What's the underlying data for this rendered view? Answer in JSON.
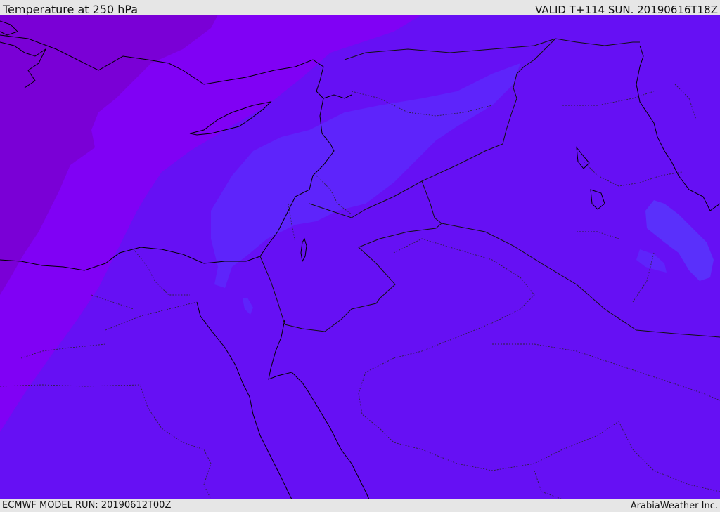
{
  "header": {
    "title": "Temperature at 250 hPa",
    "valid": "VALID T+114 SUN. 20190616T18Z"
  },
  "footer": {
    "model_run": "ECMWF MODEL RUN: 20190612T00Z",
    "credit": "ArabiaWeather Inc."
  },
  "colors": {
    "background_band": "#6610f4",
    "band_warm_1": "#5e24fb",
    "band_warm_2": "#5a30fb",
    "band_cold_1": "#8001f5",
    "band_cold_2": "#7a00d6",
    "coastline": "#000000",
    "border": "#111111"
  }
}
